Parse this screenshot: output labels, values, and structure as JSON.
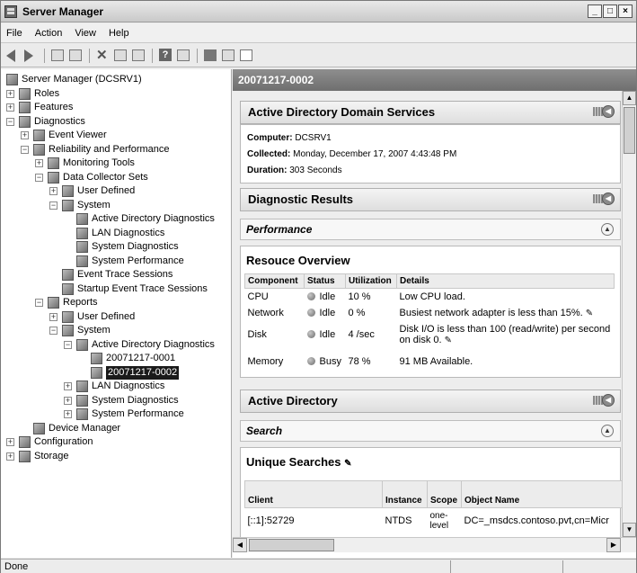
{
  "window": {
    "title": "Server Manager",
    "min": "_",
    "max": "□",
    "close": "×"
  },
  "menu": [
    "File",
    "Action",
    "View",
    "Help"
  ],
  "tree": [
    {
      "label": "Server Manager (DCSRV1)",
      "level": 0,
      "exp": ""
    },
    {
      "label": "Roles",
      "level": 0,
      "exp": "+"
    },
    {
      "label": "Features",
      "level": 0,
      "exp": "+"
    },
    {
      "label": "Diagnostics",
      "level": 0,
      "exp": "−"
    },
    {
      "label": "Event Viewer",
      "level": 1,
      "exp": "+"
    },
    {
      "label": "Reliability and Performance",
      "level": 1,
      "exp": "−"
    },
    {
      "label": "Monitoring Tools",
      "level": 2,
      "exp": "+"
    },
    {
      "label": "Data Collector Sets",
      "level": 2,
      "exp": "−"
    },
    {
      "label": "User Defined",
      "level": 3,
      "exp": "+"
    },
    {
      "label": "System",
      "level": 3,
      "exp": "−"
    },
    {
      "label": "Active Directory Diagnostics",
      "level": 4,
      "exp": ""
    },
    {
      "label": "LAN Diagnostics",
      "level": 4,
      "exp": ""
    },
    {
      "label": "System Diagnostics",
      "level": 4,
      "exp": ""
    },
    {
      "label": "System Performance",
      "level": 4,
      "exp": ""
    },
    {
      "label": "Event Trace Sessions",
      "level": 3,
      "exp": ""
    },
    {
      "label": "Startup Event Trace Sessions",
      "level": 3,
      "exp": ""
    },
    {
      "label": "Reports",
      "level": 2,
      "exp": "−"
    },
    {
      "label": "User Defined",
      "level": 3,
      "exp": "+"
    },
    {
      "label": "System",
      "level": 3,
      "exp": "−"
    },
    {
      "label": "Active Directory Diagnostics",
      "level": 4,
      "exp": "−"
    },
    {
      "label": "20071217-0001",
      "level": 5,
      "exp": ""
    },
    {
      "label": "20071217-0002",
      "level": 5,
      "exp": "",
      "selected": true
    },
    {
      "label": "LAN Diagnostics",
      "level": 4,
      "exp": "+"
    },
    {
      "label": "System Diagnostics",
      "level": 4,
      "exp": "+"
    },
    {
      "label": "System Performance",
      "level": 4,
      "exp": "+"
    },
    {
      "label": "Device Manager",
      "level": 1,
      "exp": ""
    },
    {
      "label": "Configuration",
      "level": 0,
      "exp": "+"
    },
    {
      "label": "Storage",
      "level": 0,
      "exp": "+"
    }
  ],
  "right": {
    "header": "20071217-0002",
    "ads": {
      "title": "Active Directory Domain Services",
      "computer_key": "Computer:",
      "computer_val": "DCSRV1",
      "collected_key": "Collected:",
      "collected_val": "Monday, December 17, 2007 4:43:48 PM",
      "duration_key": "Duration:",
      "duration_val": "303 Seconds"
    },
    "diag_title": "Diagnostic Results",
    "perf_title": "Performance",
    "overview": {
      "title": "Resouce Overview",
      "headers": [
        "Component",
        "Status",
        "Utilization",
        "Details"
      ],
      "rows": [
        {
          "component": "CPU",
          "status": "Idle",
          "util": "10 %",
          "details": "Low CPU load."
        },
        {
          "component": "Network",
          "status": "Idle",
          "util": "0 %",
          "details": "Busiest network adapter is less than 15%."
        },
        {
          "component": "Disk",
          "status": "Idle",
          "util": "4 /sec",
          "details": "Disk I/O is less than 100 (read/write) per second on disk 0."
        },
        {
          "component": "Memory",
          "status": "Busy",
          "util": "78 %",
          "details": "91 MB Available."
        }
      ]
    },
    "ad_title": "Active Directory",
    "search_title": "Search",
    "unique": {
      "title": "Unique Searches",
      "headers": [
        "Client",
        "Instance",
        "Scope",
        "Object Name"
      ],
      "rows": [
        {
          "client": "[::1]:52729",
          "instance": "NTDS",
          "scope": "one-level",
          "object": "DC=_msdcs.contoso.pvt,cn=Micr"
        }
      ]
    }
  },
  "status": {
    "text": "Done"
  }
}
